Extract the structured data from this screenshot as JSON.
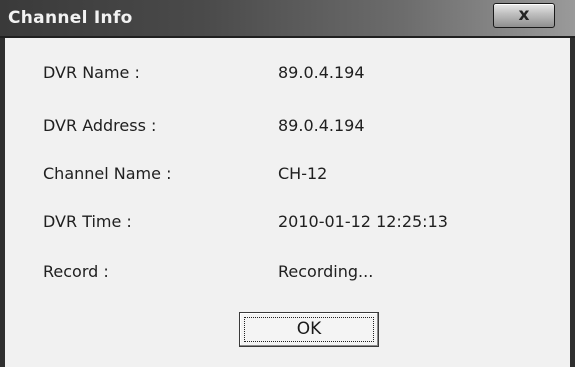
{
  "window": {
    "title": "Channel Info",
    "close_label": "x",
    "close_icon": "close-icon"
  },
  "fields": [
    {
      "label": "DVR Name :",
      "value": "89.0.4.194"
    },
    {
      "label": "DVR Address :",
      "value": "89.0.4.194"
    },
    {
      "label": "Channel Name :",
      "value": "CH-12"
    },
    {
      "label": "DVR Time :",
      "value": "2010-01-12 12:25:13"
    },
    {
      "label": "Record :",
      "value": "Recording..."
    }
  ],
  "buttons": {
    "ok_label": "OK"
  },
  "colors": {
    "titlebar": "#3a3a3a",
    "dialog_bg": "#f1f1f1",
    "text": "#202020"
  }
}
